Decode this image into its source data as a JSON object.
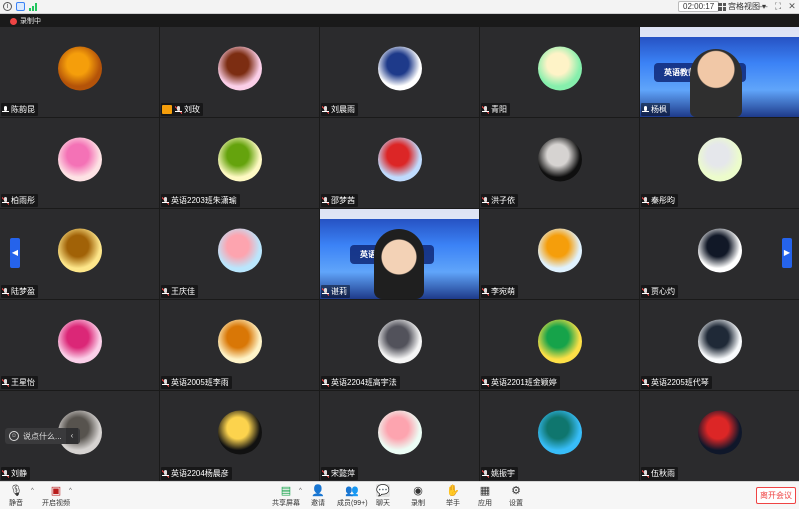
{
  "titlebar": {
    "timer": "02:00:17",
    "view_label": "宫格视图",
    "view_caret": "▾"
  },
  "recording": {
    "label": "录制中"
  },
  "participants": [
    {
      "name": "陈韵昆",
      "avatar": "autumn-tree",
      "colors": [
        "#b45309",
        "#f59e0b"
      ]
    },
    {
      "name": "刘玫",
      "avatar": "girl-glasses",
      "colors": [
        "#fbcfe8",
        "#7c2d12"
      ],
      "badge": true
    },
    {
      "name": "刘晨雨",
      "avatar": "cartoon-figure",
      "colors": [
        "#ffffff",
        "#1e3a8a"
      ]
    },
    {
      "name": "青阳",
      "avatar": "plush-toy",
      "colors": [
        "#86efac",
        "#fef3c7"
      ]
    },
    {
      "name": "杨枫",
      "video": "teacher-slide"
    },
    {
      "name": "柏雨彤",
      "avatar": "cartoon-girl",
      "colors": [
        "#fde2e4",
        "#f472b6"
      ]
    },
    {
      "name": "英语2203班朱潇瑜",
      "avatar": "girl-outdoor",
      "colors": [
        "#fef9c3",
        "#65a30d"
      ]
    },
    {
      "name": "邵梦茜",
      "avatar": "girl-red-hat",
      "colors": [
        "#bfdbfe",
        "#dc2626"
      ]
    },
    {
      "name": "洪子依",
      "avatar": "dark-portrait",
      "colors": [
        "#0f0f0f",
        "#d6d3d1"
      ]
    },
    {
      "name": "秦彤昀",
      "avatar": "girl-white-dress",
      "colors": [
        "#ecfccb",
        "#e5e7eb"
      ]
    },
    {
      "name": "陆梦盈",
      "avatar": "girl-soft",
      "colors": [
        "#fde68a",
        "#a16207"
      ]
    },
    {
      "name": "王庆佳",
      "avatar": "sky-figure",
      "colors": [
        "#bae6fd",
        "#fda4af"
      ]
    },
    {
      "name": "谌莉",
      "video": "student-slide"
    },
    {
      "name": "李宛萌",
      "avatar": "anime-boy",
      "colors": [
        "#e0f2fe",
        "#f59e0b"
      ]
    },
    {
      "name": "贾心灼",
      "avatar": "sketch",
      "colors": [
        "#ffffff",
        "#111827"
      ]
    },
    {
      "name": "王星怡",
      "avatar": "girl-flowers",
      "colors": [
        "#fbcfe8",
        "#db2777"
      ]
    },
    {
      "name": "英语2005班李雨",
      "avatar": "wheat",
      "colors": [
        "#fef3c7",
        "#d97706"
      ]
    },
    {
      "name": "英语2204班高宇法",
      "avatar": "white-dog",
      "colors": [
        "#f5f5f5",
        "#52525b"
      ]
    },
    {
      "name": "英语2201班金颖婷",
      "avatar": "english-cartoon",
      "colors": [
        "#fde047",
        "#16a34a"
      ]
    },
    {
      "name": "英语2205班代琴",
      "avatar": "man-statue",
      "colors": [
        "#f8fafc",
        "#1f2937"
      ]
    },
    {
      "name": "刘静",
      "avatar": "cat",
      "colors": [
        "#d6d3d1",
        "#57534e"
      ]
    },
    {
      "name": "英语2204杨晨彦",
      "avatar": "ginkgo",
      "colors": [
        "#111111",
        "#fcd34d"
      ]
    },
    {
      "name": "宋懿萍",
      "avatar": "blush-face",
      "colors": [
        "#ecfdf5",
        "#fda4af"
      ]
    },
    {
      "name": "姚振宇",
      "avatar": "seascape",
      "colors": [
        "#38bdf8",
        "#0f766e"
      ]
    },
    {
      "name": "伍秋雨",
      "avatar": "silhouette-red",
      "colors": [
        "#0f172a",
        "#dc2626"
      ]
    }
  ],
  "slides": {
    "teacher": "英语教师的精彩的天",
    "student": "英语教师精彩的天"
  },
  "chat_input": {
    "placeholder": "说点什么..."
  },
  "toolbar": {
    "mute": "静音",
    "video": "开启视频",
    "share": "共享屏幕",
    "invite": "邀请",
    "members": "成员(99+)",
    "chat": "聊天",
    "record": "录制",
    "raise_hand": "举手",
    "apps": "应用",
    "settings": "设置",
    "leave": "离开会议"
  }
}
